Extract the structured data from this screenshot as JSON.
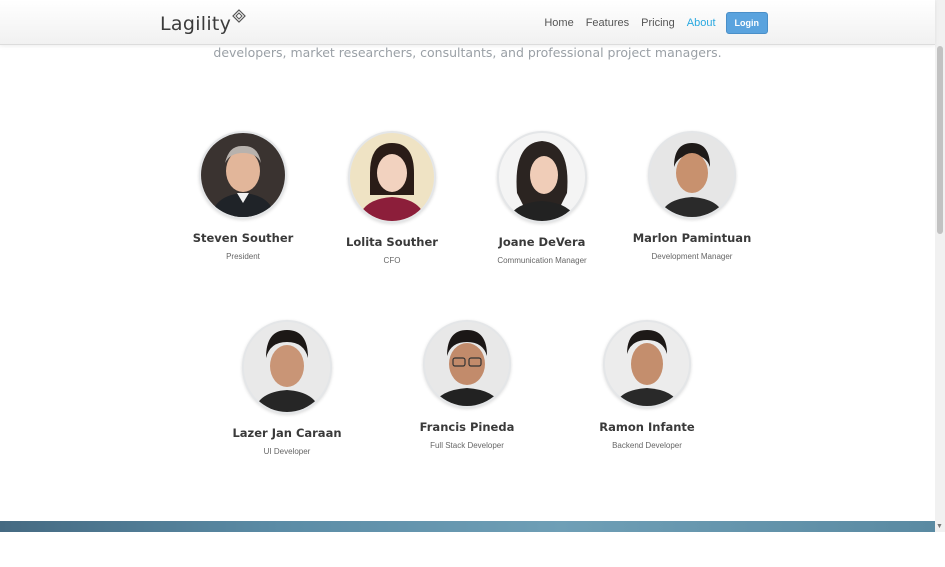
{
  "brand": {
    "name": "Lagility"
  },
  "nav": {
    "items": [
      {
        "label": "Home"
      },
      {
        "label": "Features"
      },
      {
        "label": "Pricing"
      },
      {
        "label": "About",
        "active": true
      }
    ],
    "login_label": "Login"
  },
  "intro_text": "developers, market researchers, consultants, and professional project managers.",
  "team": [
    {
      "name": "Steven Souther",
      "role": "President",
      "photo": "person-photo"
    },
    {
      "name": "Lolita Souther",
      "role": "CFO",
      "photo": "person-photo"
    },
    {
      "name": "Joane DeVera",
      "role": "Communication Manager",
      "photo": "person-photo"
    },
    {
      "name": "Marlon Pamintuan",
      "role": "Development Manager",
      "photo": "person-photo"
    },
    {
      "name": "Lazer Jan Caraan",
      "role": "UI Developer",
      "photo": "person-photo"
    },
    {
      "name": "Francis Pineda",
      "role": "Full Stack Developer",
      "photo": "person-photo"
    },
    {
      "name": "Ramon Infante",
      "role": "Backend Developer",
      "photo": "person-photo"
    }
  ],
  "colors": {
    "accent": "#29a8e0",
    "button": "#5aa3de"
  }
}
